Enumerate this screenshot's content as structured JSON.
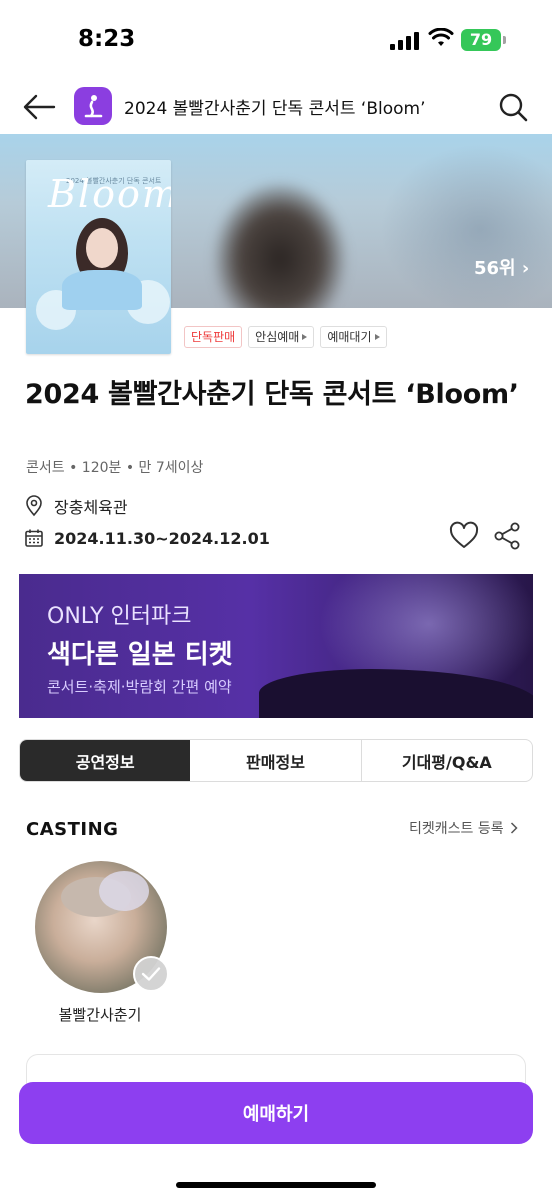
{
  "status": {
    "time": "8:23",
    "battery": "79"
  },
  "nav": {
    "title": "2024 볼빨간사춘기 단독 콘서트 ‘Bloom’"
  },
  "hero": {
    "rank": "56위 ›"
  },
  "poster": {
    "title": "Bloom",
    "subtitle": "2024 볼빨간사춘기 단독 콘서트"
  },
  "badges": [
    {
      "label": "단독판매"
    },
    {
      "label": "안심예매"
    },
    {
      "label": "예매대기"
    }
  ],
  "event": {
    "title": "2024 볼빨간사춘기 단독 콘서트 ‘Bloom’",
    "meta": "콘서트 • 120분 • 만 7세이상",
    "venue": "장충체육관",
    "dates": "2024.11.30~2024.12.01"
  },
  "banner": {
    "line1": "ONLY 인터파크",
    "line2": "색다른 일본 티켓",
    "line3": "콘서트·축제·박람회 간편 예약"
  },
  "tabs": [
    {
      "label": "공연정보",
      "active": true
    },
    {
      "label": "판매정보",
      "active": false
    },
    {
      "label": "기대평/Q&A",
      "active": false
    }
  ],
  "casting": {
    "title": "CASTING",
    "link": "티켓캐스트 등록",
    "cast": [
      {
        "name": "볼빨간사춘기"
      }
    ]
  },
  "cta": {
    "label": "예매하기"
  },
  "colors": {
    "accent": "#8d3ff0",
    "badge_red": "#ee3a3a",
    "battery": "#35c759"
  }
}
